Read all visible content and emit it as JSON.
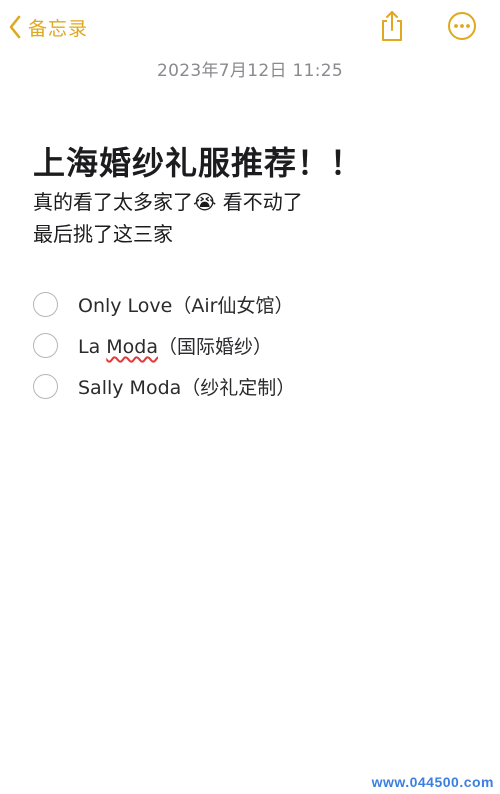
{
  "nav": {
    "back_label": "备忘录",
    "back_icon": "chevron-left-icon",
    "share_icon": "share-icon",
    "more_icon": "ellipsis-circle-icon",
    "accent_color": "#e0a81e"
  },
  "note": {
    "timestamp": "2023年7月12日 11:25",
    "title": "上海婚纱礼服推荐！！",
    "body_line1_prefix": "真的看了太多家了",
    "body_line1_emoji": "😭",
    "body_line1_suffix": " 看不动了",
    "body_line2": "最后挑了这三家",
    "checklist": [
      {
        "label": "Only Love（Air仙女馆）",
        "checked": false
      },
      {
        "label_before": "La ",
        "label_misspelled": "Moda",
        "label_after": "（国际婚纱）",
        "checked": false
      },
      {
        "label": "Sally Moda（纱礼定制）",
        "checked": false
      }
    ]
  },
  "watermark": "www.044500.com"
}
